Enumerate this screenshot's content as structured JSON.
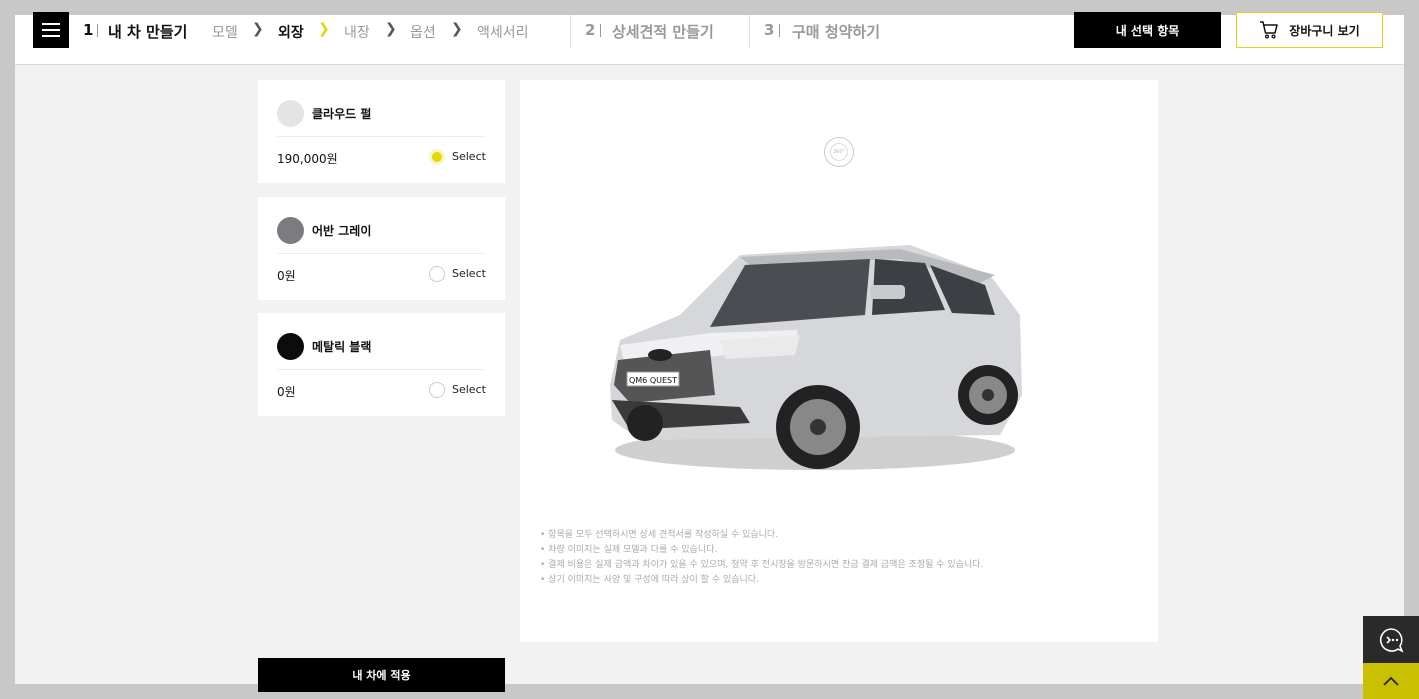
{
  "header": {
    "step1": {
      "num": "1",
      "title": "내 차 만들기"
    },
    "substeps": [
      "모델",
      "외장",
      "내장",
      "옵션",
      "액세서리"
    ],
    "active_substep": "외장",
    "step2": {
      "num": "2",
      "title": "상세견적 만들기"
    },
    "step3": {
      "num": "3",
      "title": "구매 청약하기"
    },
    "my_selection_label": "내 선택 항목",
    "cart_label": "장바구니 보기"
  },
  "colors": [
    {
      "name": "클라우드 펄",
      "price": "190,000원",
      "select_label": "Select",
      "selected": true,
      "hex": "#e4e4e4"
    },
    {
      "name": "어반 그레이",
      "price": "0원",
      "select_label": "Select",
      "selected": false,
      "hex": "#7c7c80"
    },
    {
      "name": "메탈릭 블랙",
      "price": "0원",
      "select_label": "Select",
      "selected": false,
      "hex": "#0c0c0c"
    }
  ],
  "preview": {
    "badge_text": "360°",
    "plate_text": "QM6 QUEST",
    "notes": [
      "• 항목을 모두 선택하시면 상세 견적서를 작성하실 수 있습니다.",
      "• 차량 이미지는 실제 모델과 다를 수 있습니다.",
      "• 결제 비용은 실제 금액과 차이가 있을 수 있으며, 청약 후 전시장을 방문하시면 잔금 결제 금액은 조정될 수 있습니다.",
      "• 상기 이미지는 사양 및 구성에 따라 상이 할 수 있습니다."
    ]
  },
  "apply_label": "내 차에 적용",
  "accent": "#e6d800"
}
